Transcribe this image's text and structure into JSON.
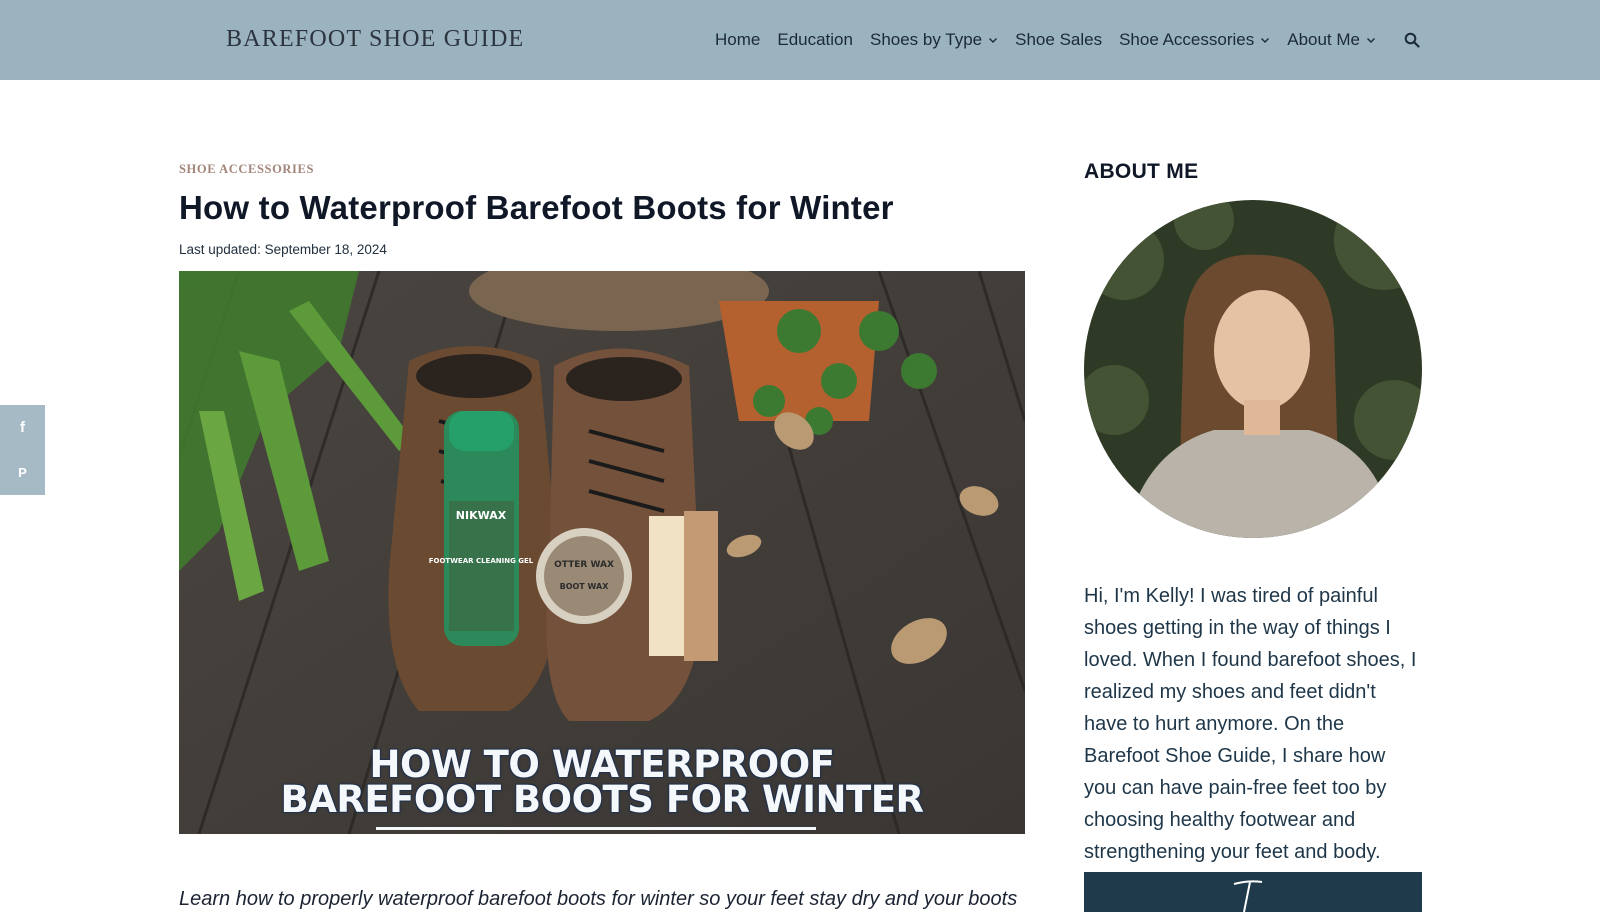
{
  "site": {
    "brand": "BAREFOOT SHOE GUIDE"
  },
  "nav": {
    "items": [
      {
        "label": "Home",
        "has_dropdown": false
      },
      {
        "label": "Education",
        "has_dropdown": false
      },
      {
        "label": "Shoes by Type",
        "has_dropdown": true
      },
      {
        "label": "Shoe Sales",
        "has_dropdown": false
      },
      {
        "label": "Shoe Accessories",
        "has_dropdown": true
      },
      {
        "label": "About Me",
        "has_dropdown": true
      }
    ],
    "search_icon": "search-icon"
  },
  "share": {
    "facebook": "f",
    "pinterest": "P"
  },
  "article": {
    "category": "SHOE ACCESSORIES",
    "title": "How to Waterproof Barefoot Boots for Winter",
    "updated": "Last updated: September 18, 2024",
    "hero": {
      "line1": "HOW TO WATERPROOF",
      "line2": "BAREFOOT BOOTS FOR WINTER",
      "product1_brand": "NIKWAX",
      "product1_name": "FOOTWEAR CLEANING GEL",
      "product2_brand": "OTTER WAX",
      "product2_name": "BOOT WAX"
    },
    "intro": "Learn how to properly waterproof barefoot boots for winter so your feet stay dry and your boots"
  },
  "sidebar": {
    "title": "ABOUT ME",
    "bio": "Hi, I'm Kelly! I was tired of painful shoes getting in the way of things I loved. When I found barefoot shoes, I realized my shoes and feet didn't have to hurt anymore. On the Barefoot Shoe Guide, I share how you can have pain-free feet too by choosing healthy footwear and strengthening your feet and body."
  },
  "colors": {
    "header_bg": "#9bb2bf",
    "category": "#a2867a",
    "share_bg": "#a6bac6",
    "promo_bg": "#1f3a4a"
  }
}
